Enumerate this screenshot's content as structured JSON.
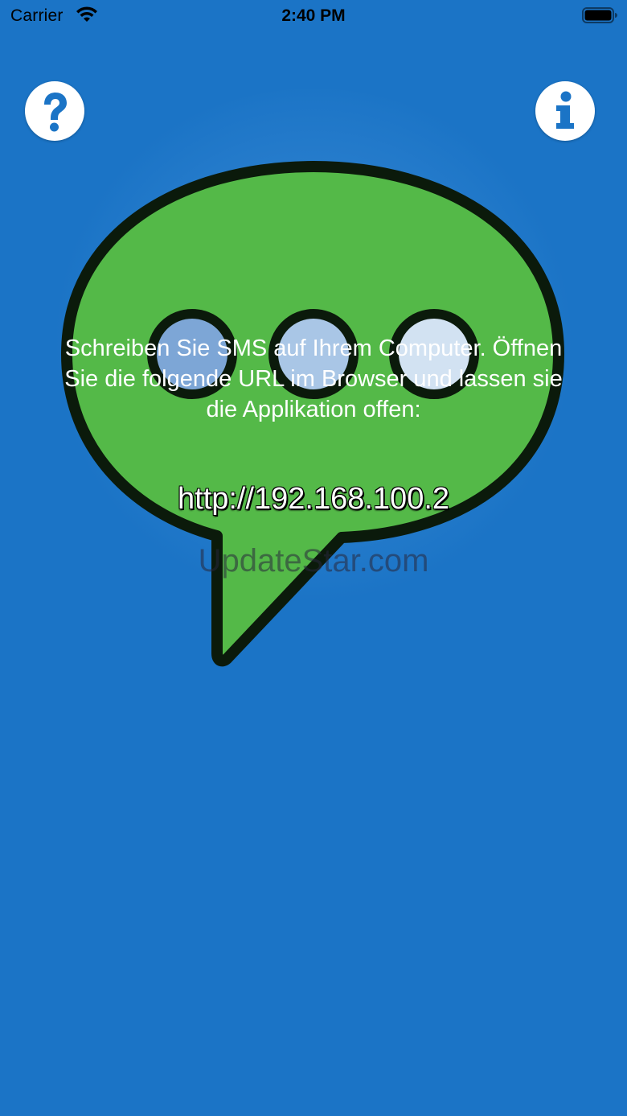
{
  "status_bar": {
    "carrier": "Carrier",
    "time": "2:40 PM",
    "wifi_icon": "wifi-icon",
    "battery_icon": "battery-icon"
  },
  "header": {
    "help_icon": "question-mark-icon",
    "info_icon": "info-icon"
  },
  "main": {
    "illustration": "chat-bubble-icon",
    "instructions": "Schreiben Sie SMS auf Ihrem Computer. Öffnen\nSie die folgende URL im Browser und lassen sie\ndie Applikation offen:",
    "url": "http://192.168.100.2",
    "watermark": "UpdateStar.com"
  },
  "colors": {
    "background": "#1b74c6",
    "bubble_fill": "#54b948",
    "bubble_outline": "#0b1a0b",
    "button_icon": "#1b74c6"
  }
}
